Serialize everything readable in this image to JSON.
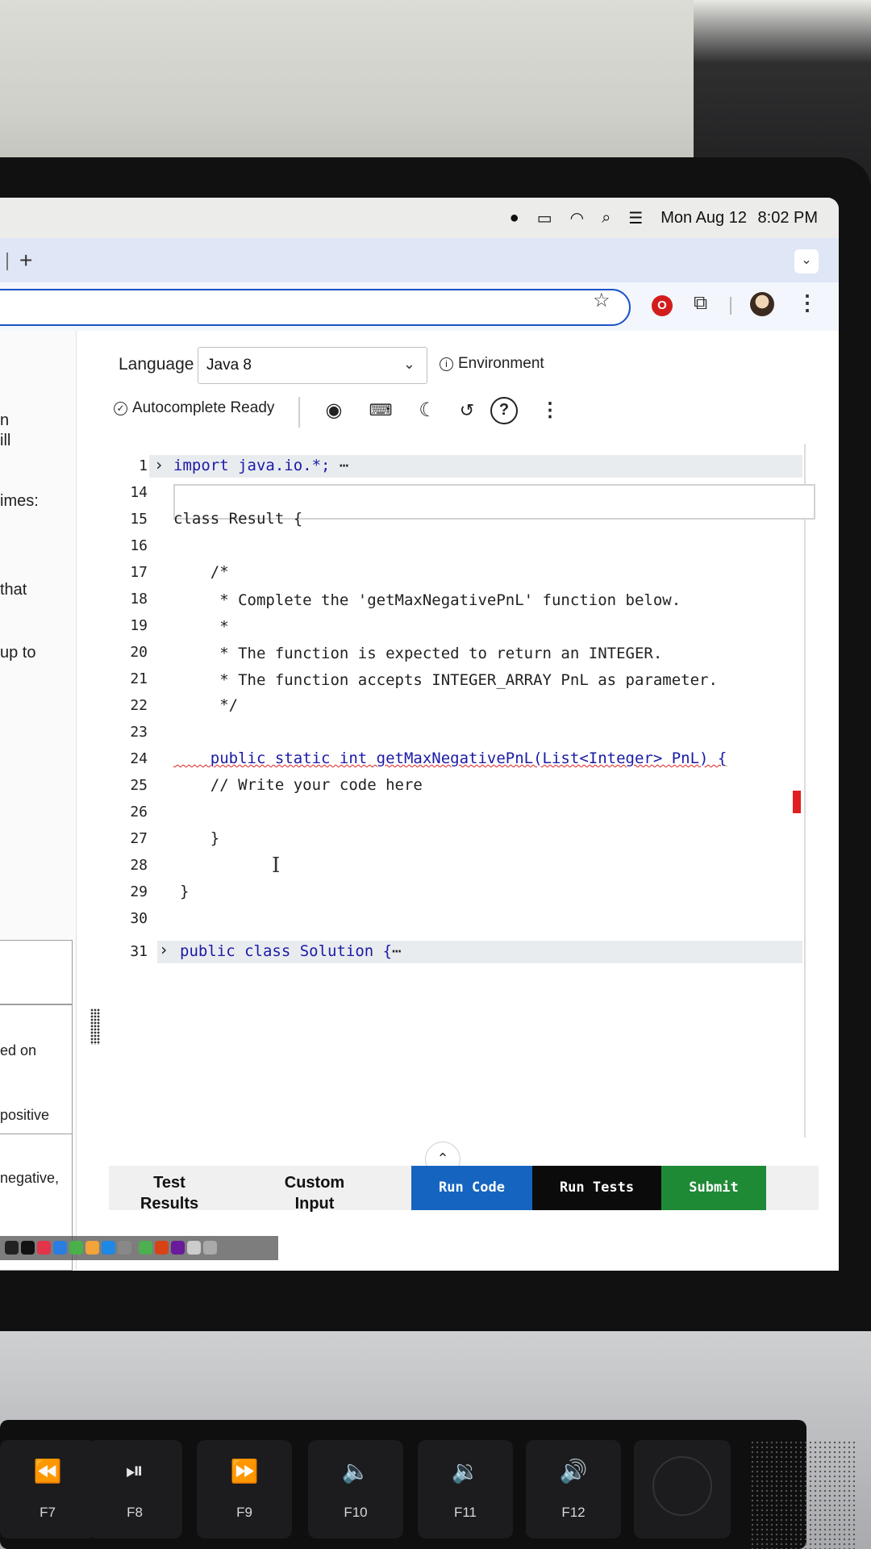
{
  "menubar": {
    "date": "Mon Aug 12",
    "time": "8:02 PM",
    "icons": [
      "apple-logo-icon",
      "battery-icon",
      "wifi-icon",
      "search-icon",
      "control-center-icon"
    ]
  },
  "browser": {
    "new_tab": "+",
    "tab_chevron": "⌄",
    "star": "☆",
    "ext_badge": "O",
    "menu": "⋮"
  },
  "left_panel": {
    "fragments": [
      "n",
      "ill",
      "imes:",
      "that",
      "up to",
      "ed on",
      "positive",
      "negative,"
    ]
  },
  "editor": {
    "language_label": "Language",
    "language_value": "Java 8",
    "environment": "Environment",
    "autocomplete": "Autocomplete Ready",
    "toolbar_icons": [
      "eye-icon",
      "keyboard-icon",
      "moon-icon",
      "history-icon",
      "help-icon",
      "more-icon"
    ]
  },
  "code_lines": [
    {
      "n": "1",
      "text": "import java.io.*;",
      "folded": true
    },
    {
      "n": "14",
      "text": ""
    },
    {
      "n": "15",
      "text": "class Result {"
    },
    {
      "n": "16",
      "text": ""
    },
    {
      "n": "17",
      "text": "    /*"
    },
    {
      "n": "18",
      "text": "     * Complete the 'getMaxNegativePnL' function below."
    },
    {
      "n": "19",
      "text": "     *"
    },
    {
      "n": "20",
      "text": "     * The function is expected to return an INTEGER."
    },
    {
      "n": "21",
      "text": "     * The function accepts INTEGER_ARRAY PnL as parameter."
    },
    {
      "n": "22",
      "text": "     */"
    },
    {
      "n": "23",
      "text": ""
    },
    {
      "n": "24",
      "text": "    public static int getMaxNegativePnL(List<Integer> PnL) {"
    },
    {
      "n": "25",
      "text": "    // Write your code here"
    },
    {
      "n": "26",
      "text": ""
    },
    {
      "n": "27",
      "text": "    }"
    },
    {
      "n": "28",
      "text": ""
    },
    {
      "n": "29",
      "text": "}"
    },
    {
      "n": "30",
      "text": ""
    },
    {
      "n": "31",
      "text": "public class Solution {",
      "folded": true
    }
  ],
  "fold_ellipsis": "⋯",
  "bottom": {
    "test_results": "Test Results",
    "custom_input": "Custom Input",
    "run_code": "Run Code",
    "run_tests": "Run Tests",
    "submit": "Submit",
    "run_code_color": "#1565c0",
    "run_tests_color": "#0b0b0b",
    "submit_color": "#1f8a36"
  },
  "keyboard": [
    {
      "f": "F7",
      "icon": "rewind-icon",
      "glyph": "⏪"
    },
    {
      "f": "F8",
      "icon": "play-pause-icon",
      "glyph": "⏯"
    },
    {
      "f": "F9",
      "icon": "fast-forward-icon",
      "glyph": "⏩"
    },
    {
      "f": "F10",
      "icon": "mute-icon",
      "glyph": "🔈"
    },
    {
      "f": "F11",
      "icon": "volume-down-icon",
      "glyph": "🔉"
    },
    {
      "f": "F12",
      "icon": "volume-up-icon",
      "glyph": "🔊"
    }
  ]
}
